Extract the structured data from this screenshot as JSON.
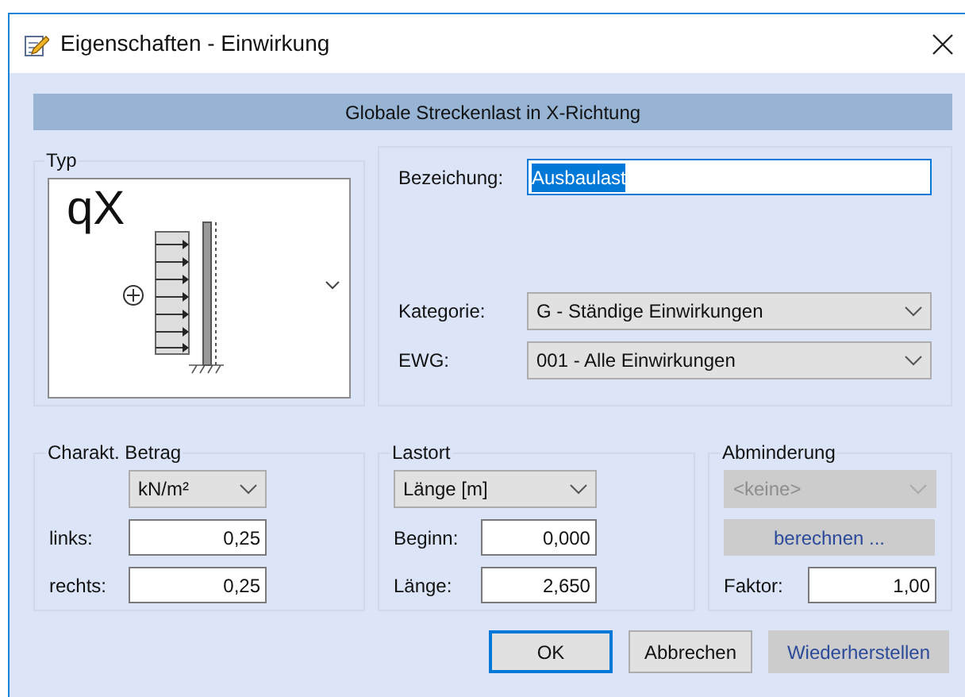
{
  "window": {
    "title": "Eigenschaften - Einwirkung"
  },
  "header": "Globale Streckenlast in X-Richtung",
  "typ": {
    "legend": "Typ",
    "symbol": "qX"
  },
  "general": {
    "fields": [
      {
        "kind": "text",
        "label": "Bezeichung:",
        "value": "Ausbaulast",
        "text_selected": true
      },
      {
        "kind": "combo",
        "label": "Kategorie:",
        "value": "G - Ständige Einwirkungen"
      },
      {
        "kind": "combo",
        "label": "EWG:",
        "value": "001 - Alle Einwirkungen"
      }
    ]
  },
  "groups": [
    {
      "legend": "Charakt. Betrag",
      "rows": [
        {
          "kind": "combo",
          "value": "kN/m²",
          "disabled": false
        },
        {
          "kind": "number",
          "label": "links:",
          "value": "0,25"
        },
        {
          "kind": "number",
          "label": "rechts:",
          "value": "0,25"
        }
      ]
    },
    {
      "legend": "Lastort",
      "rows": [
        {
          "kind": "combo",
          "value": "Länge [m]",
          "disabled": false
        },
        {
          "kind": "number",
          "label": "Beginn:",
          "value": "0,000"
        },
        {
          "kind": "number",
          "label": "Länge:",
          "value": "2,650"
        }
      ]
    },
    {
      "legend": "Abminderung",
      "rows": [
        {
          "kind": "combo",
          "value": "<keine>",
          "disabled": true
        },
        {
          "kind": "button",
          "label": "berechnen ...",
          "disabled": true
        },
        {
          "kind": "number",
          "label": "Faktor:",
          "value": "1,00"
        }
      ]
    }
  ],
  "buttons": [
    {
      "label": "OK",
      "default": true,
      "disabled": false
    },
    {
      "label": "Abbrechen",
      "default": false,
      "disabled": false
    },
    {
      "label": "Wiederherstellen",
      "default": false,
      "disabled": true
    }
  ]
}
